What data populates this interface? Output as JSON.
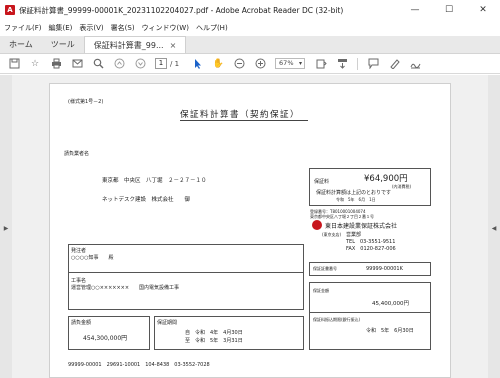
{
  "window": {
    "app_icon": "pdf-icon",
    "title": "保証料計算書_99999-00001K_20231102204027.pdf - Adobe Acrobat Reader DC (32-bit)",
    "minimize": "—",
    "maximize": "☐",
    "close": "✕"
  },
  "menu": [
    "ファイル(F)",
    "編集(E)",
    "表示(V)",
    "署名(S)",
    "ウィンドウ(W)",
    "ヘルプ(H)"
  ],
  "tabs": {
    "home": "ホーム",
    "tools": "ツール",
    "document": "保証料計算書_99...",
    "close": "×"
  },
  "toolbar": {
    "page_current": "1",
    "page_total": "/ 1",
    "zoom": "67%",
    "icons": [
      "save-icon",
      "bookmark-star-icon",
      "print-icon",
      "email-icon",
      "search-icon",
      "page-up-icon",
      "page-down-icon",
      "select-cursor-icon",
      "hand-tool-icon",
      "zoom-out-icon",
      "zoom-in-icon",
      "fit-page-icon",
      "scroll-mode-icon",
      "comment-icon",
      "highlight-pen-icon",
      "sign-icon"
    ]
  },
  "document": {
    "form_no": "(様式第1号－2)",
    "title": "保証料計算書（契約保証）",
    "addressee_label": "請負業者名",
    "address": "東京都　中央区　八丁堀　２－２７－１０",
    "company_name": "ネットデスク建設　株式会社　　御",
    "guarantee_fee_label": "保証料",
    "guarantee_fee": "¥64,900円",
    "tax_note": "(内消費税)",
    "fee_text": "保証料計算額は上記のとおりです",
    "date_small": "令和　5年　6月　1日",
    "reg_no": "登録番号：T8010001004074",
    "issuer_address": "東京都中央区八丁堀２丁目２番１号",
    "issuer_name": "東日本建設業保証株式会社",
    "branch_label": "(東京支店)",
    "branch": "営業部",
    "tel": "TEL　03-3551-9511",
    "fax": "FAX　0120-827-006",
    "orderer_label": "発注者",
    "orderer": "○○○○知事　　殿",
    "work_label": "工事名",
    "work_name": "運営管理○○×××××××　　国内電気設備工事",
    "contract_amount_label": "請負金額",
    "contract_amount": "454,300,000円",
    "guarantee_period_label": "保証期間",
    "period_from": "自　令和　4年　4月30日",
    "period_to": "至　令和　5年　3月31日",
    "guarantee_no_label": "保証証書番号",
    "guarantee_no": "99999-00001K",
    "premium_label": "保証金額",
    "premium_amount": "45,400,000円",
    "payment_label": "保証料振込期限(銀行振込)",
    "payment_date": "令和　5年　6月30日",
    "footer_code": "99999-00001　29691-10001　104-8438　03-3552-7028"
  }
}
